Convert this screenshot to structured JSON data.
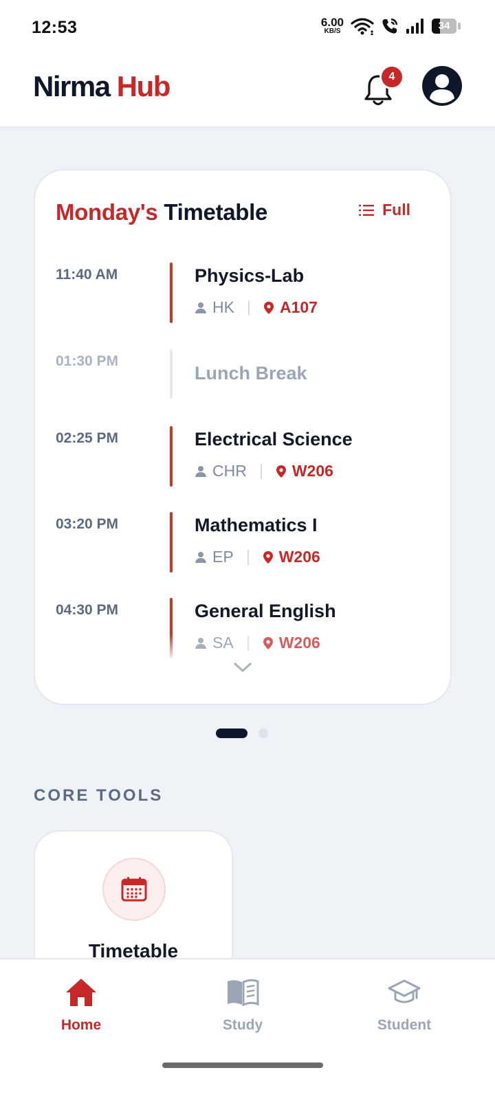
{
  "status_bar": {
    "time": "12:53",
    "net_speed_value": "6.00",
    "net_speed_unit": "KB/S",
    "battery": "34"
  },
  "header": {
    "brand_part1": "Nirma",
    "brand_part2": "Hub",
    "notification_count": "4"
  },
  "timetable": {
    "title_day": "Monday's",
    "title_rest": "Timetable",
    "full_label": "Full",
    "slots": [
      {
        "time": "11:40 AM",
        "subject": "Physics-Lab",
        "faculty": "HK",
        "room": "A107"
      },
      {
        "time": "01:30 PM",
        "subject": "Lunch Break"
      },
      {
        "time": "02:25 PM",
        "subject": "Electrical Science",
        "faculty": "CHR",
        "room": "W206"
      },
      {
        "time": "03:20 PM",
        "subject": "Mathematics I",
        "faculty": "EP",
        "room": "W206"
      },
      {
        "time": "04:30 PM",
        "subject": "General English",
        "faculty": "SA",
        "room": "W206"
      }
    ]
  },
  "core_tools": {
    "title": "CORE TOOLS",
    "items": [
      {
        "label": "Timetable",
        "icon": "calendar-icon"
      }
    ]
  },
  "bottom_nav": {
    "items": [
      {
        "label": "Home",
        "icon": "home-icon",
        "active": true
      },
      {
        "label": "Study",
        "icon": "book-icon",
        "active": false
      },
      {
        "label": "Student",
        "icon": "graduation-cap-icon",
        "active": false
      }
    ]
  },
  "colors": {
    "brand_red": "#c62828",
    "navy": "#0f172a",
    "muted": "#9aa5b5",
    "background": "#eff3f8"
  }
}
